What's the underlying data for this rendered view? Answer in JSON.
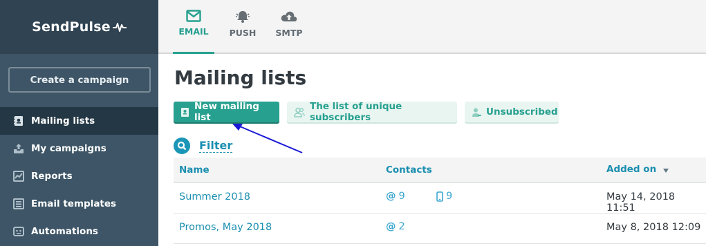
{
  "brand": {
    "name": "SendPulse"
  },
  "sidebar": {
    "create_button": "Create a campaign",
    "items": [
      {
        "label": "Mailing lists",
        "icon": "list-book-icon",
        "active": true
      },
      {
        "label": "My campaigns",
        "icon": "upload-tray-icon",
        "active": false
      },
      {
        "label": "Reports",
        "icon": "chart-icon",
        "active": false
      },
      {
        "label": "Email templates",
        "icon": "template-icon",
        "active": false
      },
      {
        "label": "Automations",
        "icon": "robot-icon",
        "active": false
      }
    ]
  },
  "topnav": {
    "tabs": [
      {
        "label": "EMAIL",
        "icon": "envelope-icon",
        "active": true
      },
      {
        "label": "PUSH",
        "icon": "bell-icon",
        "active": false
      },
      {
        "label": "SMTP",
        "icon": "cloud-upload-icon",
        "active": false
      }
    ]
  },
  "main": {
    "title": "Mailing lists",
    "buttons": {
      "new_list": "New mailing list",
      "unique_subscribers": "The list of unique subscribers",
      "unsubscribed": "Unsubscribed"
    },
    "filter_label": "Filter",
    "table": {
      "headers": {
        "name": "Name",
        "contacts": "Contacts",
        "added_on": "Added on"
      },
      "rows": [
        {
          "name": "Summer 2018",
          "email_count": "9",
          "phone_count": "9",
          "added": "May 14, 2018 11:51"
        },
        {
          "name": "Promos, May 2018",
          "email_count": "2",
          "added": "May 8, 2018 12:09"
        }
      ]
    }
  },
  "colors": {
    "accent": "#27a08f",
    "sidebar": "#3d5566",
    "sidebar_active": "#243744",
    "link": "#1b8fb0",
    "annotation_arrow": "#1a1ad6"
  }
}
